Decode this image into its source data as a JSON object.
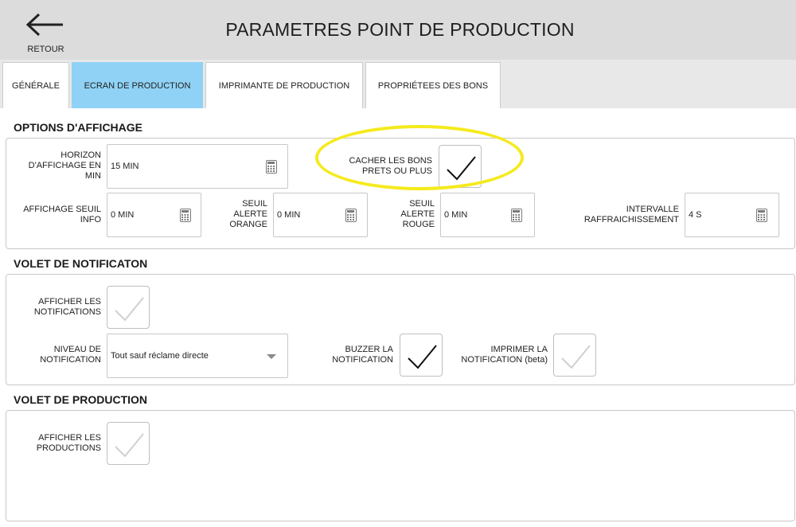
{
  "header": {
    "back_label": "RETOUR",
    "title": "PARAMETRES POINT DE PRODUCTION"
  },
  "tabs": [
    {
      "label": "GÉNÉRALE",
      "active": false
    },
    {
      "label": "ECRAN DE PRODUCTION",
      "active": true
    },
    {
      "label": "IMPRIMANTE DE PRODUCTION",
      "active": false
    },
    {
      "label": "PROPRIÉTEES DES BONS",
      "active": false
    }
  ],
  "display_options": {
    "title": "OPTIONS D'AFFICHAGE",
    "horizon": {
      "label_l1": "HORIZON",
      "label_l2": "D'AFFICHAGE EN",
      "label_l3": "MIN",
      "value": "15 MIN"
    },
    "hide_orders": {
      "label_l1": "CACHER LES BONS",
      "label_l2": "PRETS OU PLUS",
      "checked": true
    },
    "info_threshold": {
      "label_l1": "AFFICHAGE SEUIL",
      "label_l2": "INFO",
      "value": "0 MIN"
    },
    "orange_threshold": {
      "label_l1": "SEUIL",
      "label_l2": "ALERTE",
      "label_l3": "ORANGE",
      "value": "0 MIN"
    },
    "red_threshold": {
      "label_l1": "SEUIL",
      "label_l2": "ALERTE",
      "label_l3": "ROUGE",
      "value": "0 MIN"
    },
    "refresh_interval": {
      "label_l1": "INTERVALLE",
      "label_l2": "RAFFRAICHISSEMENT",
      "value": "4 S"
    }
  },
  "notification_panel": {
    "title": "VOLET DE NOTIFICATON",
    "show_notifications": {
      "label_l1": "AFFICHER LES",
      "label_l2": "NOTIFICATIONS",
      "checked": false
    },
    "notification_level": {
      "label_l1": "NIVEAU DE",
      "label_l2": "NOTIFICATION",
      "value": "Tout sauf réclame directe"
    },
    "buzzer": {
      "label_l1": "BUZZER LA",
      "label_l2": "NOTIFICATION",
      "checked": true
    },
    "print_notification": {
      "label_l1": "IMPRIMER LA",
      "label_l2": "NOTIFICATION (beta)",
      "checked": false
    }
  },
  "production_panel": {
    "title": "VOLET DE PRODUCTION",
    "show_productions": {
      "label_l1": "AFFICHER LES",
      "label_l2": "PRODUCTIONS",
      "checked": false
    }
  },
  "colors": {
    "header_bg": "#dcdcdc",
    "active_tab": "#8fd2f5",
    "highlight": "#f5ea1c",
    "check_on": "#111111",
    "check_off": "#d0d0d0"
  }
}
